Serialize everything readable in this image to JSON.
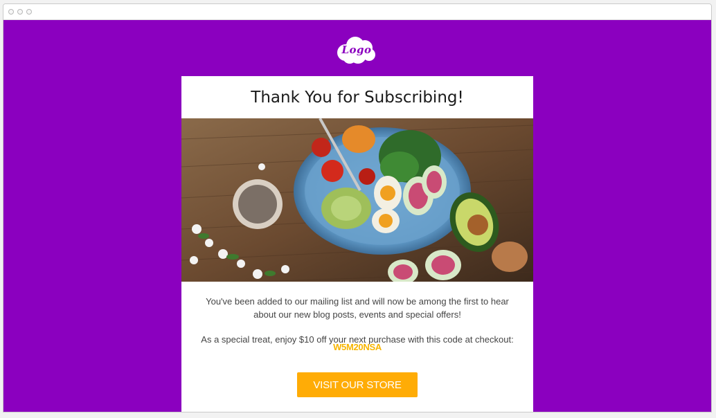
{
  "colors": {
    "page_background": "#8b00bf",
    "logo_text": "#8b00bf",
    "promo_code": "#f7b500",
    "button_background": "#ffac06",
    "button_text": "#ffffff"
  },
  "browser": {
    "window_controls": [
      "close-dot",
      "minimize-dot",
      "zoom-dot"
    ]
  },
  "header": {
    "logo_text": "Logo",
    "logo_icon": "cloud-logo-icon"
  },
  "card": {
    "title": "Thank You for Subscribing!",
    "hero_image": "food-bowl-photo",
    "intro_text": "You've been added to our mailing list and will now be among the first to hear about our new blog posts, events and special offers!",
    "offer_text": "As a special treat, enjoy $10 off your next purchase with this code at checkout:",
    "promo_code": "W5M20NSA",
    "button_label": "VISIT OUR STORE"
  }
}
